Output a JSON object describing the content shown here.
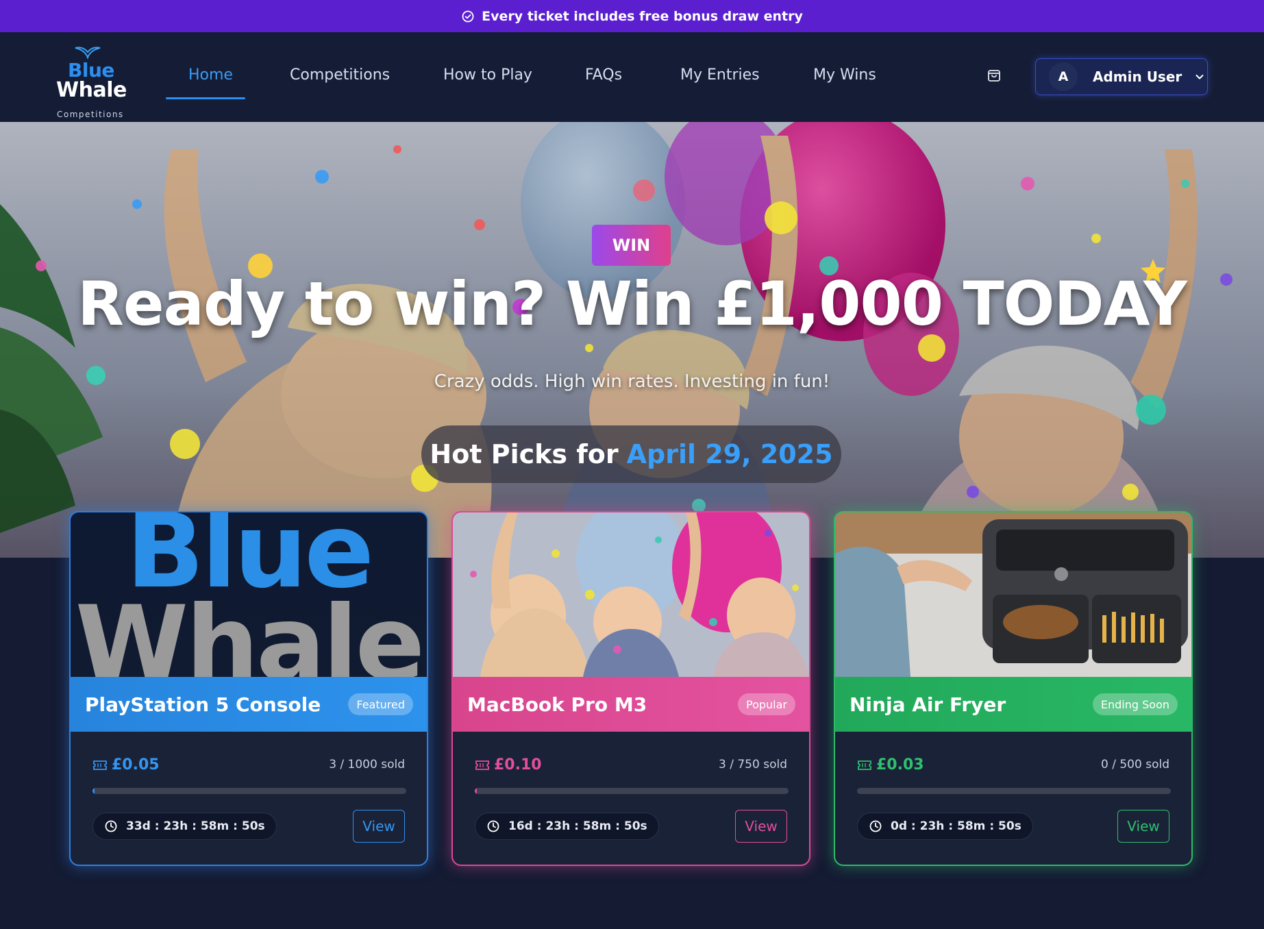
{
  "announcement": {
    "text": "Every ticket includes free bonus draw entry"
  },
  "brand": {
    "line1": "Blue",
    "line2": "Whale",
    "line3": "Competitions"
  },
  "nav": {
    "items": [
      {
        "label": "Home",
        "active": true
      },
      {
        "label": "Competitions",
        "active": false
      },
      {
        "label": "How to Play",
        "active": false
      },
      {
        "label": "FAQs",
        "active": false
      },
      {
        "label": "My Entries",
        "active": false
      },
      {
        "label": "My Wins",
        "active": false
      }
    ],
    "cart_icon": "shopping-bag-icon",
    "user": {
      "initial": "A",
      "name": "Admin User",
      "menu_icon": "chevron-down-icon"
    }
  },
  "hero": {
    "badge": "WIN",
    "title": "Ready to win? Win £1,000 TODAY",
    "subtitle": "Crazy odds. High win rates. Investing in fun!",
    "hot_picks_prefix": "Hot Picks for",
    "hot_picks_date": "April 29, 2025"
  },
  "cards": [
    {
      "title": "PlayStation 5 Console",
      "badge": "Featured",
      "image_text_1": "Blue",
      "image_text_2": "Whale",
      "price": "£0.05",
      "sold": "3 / 1000 sold",
      "progress": 0.003,
      "timer": "33d : 23h : 58m : 50s",
      "button": "View",
      "accent": "#2f8ff0"
    },
    {
      "title": "MacBook Pro M3",
      "badge": "Popular",
      "price": "£0.10",
      "sold": "3 / 750 sold",
      "progress": 0.004,
      "timer": "16d : 23h : 58m : 50s",
      "button": "View",
      "accent": "#e24f9c"
    },
    {
      "title": "Ninja Air Fryer",
      "badge": "Ending Soon",
      "price": "£0.03",
      "sold": "0 / 500 sold",
      "progress": 0,
      "timer": "0d : 23h : 58m : 50s",
      "button": "View",
      "accent": "#2fc06e"
    }
  ],
  "colors": {
    "announcement_bg": "#5b1fd0",
    "nav_bg": "#151d36",
    "page_bg": "#141b33",
    "accent_blue": "#2f8ff0",
    "accent_pink": "#e24f9c",
    "accent_green": "#2fc06e"
  }
}
